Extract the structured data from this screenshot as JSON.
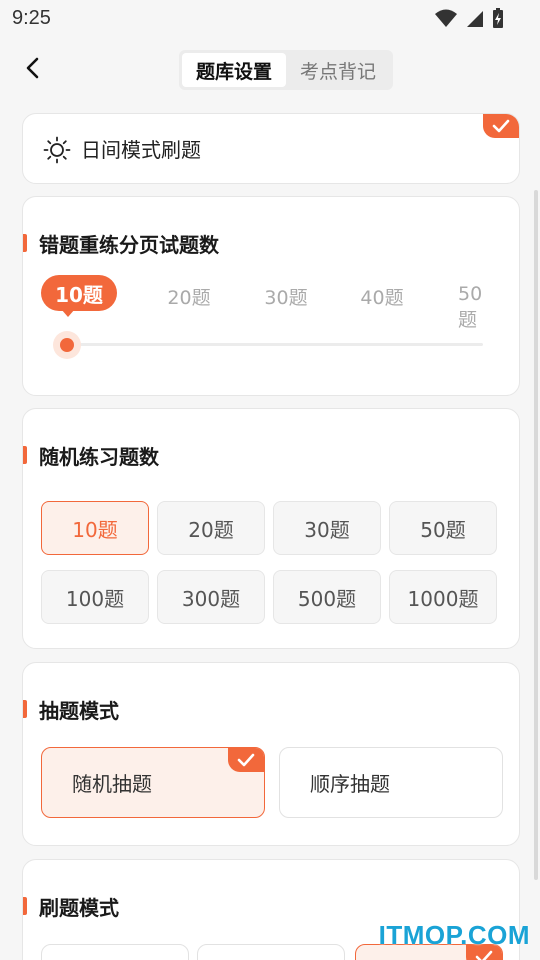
{
  "status_bar": {
    "time": "9:25"
  },
  "header": {
    "tabs": [
      {
        "label": "题库设置",
        "active": true
      },
      {
        "label": "考点背记",
        "active": false
      }
    ]
  },
  "day_mode": {
    "label": "日间模式刷题",
    "checked": true
  },
  "wrong_practice": {
    "title": "错题重练分页试题数",
    "options": [
      "10题",
      "20题",
      "30题",
      "40题",
      "50题"
    ],
    "selected": "10题"
  },
  "random_practice": {
    "title": "随机练习题数",
    "options": [
      "10题",
      "20题",
      "30题",
      "50题",
      "100题",
      "300题",
      "500题",
      "1000题"
    ],
    "selected": "10题"
  },
  "draw_mode": {
    "title": "抽题模式",
    "options": [
      "随机抽题",
      "顺序抽题"
    ],
    "selected": "随机抽题"
  },
  "brush_mode": {
    "title": "刷题模式"
  },
  "watermark": "ITMOP.COM",
  "colors": {
    "accent": "#f2683b",
    "accent_light": "#fdf0ea",
    "background": "#f6f6f6"
  }
}
